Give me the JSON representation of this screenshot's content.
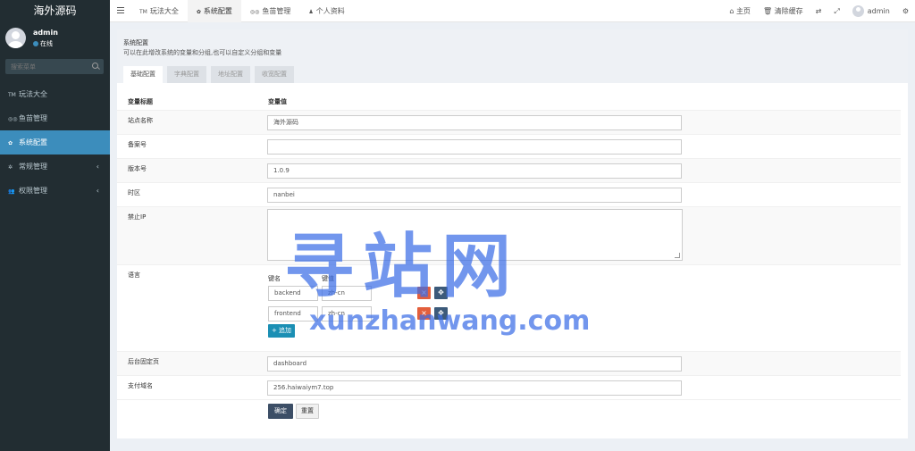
{
  "app": {
    "title": "海外源码"
  },
  "user": {
    "name": "admin",
    "status": "在线"
  },
  "sidebar": {
    "search_placeholder": "搜索菜单",
    "items": [
      {
        "label": "玩法大全",
        "icon": "tm-icon"
      },
      {
        "label": "鱼苗管理",
        "icon": "glasses-icon"
      },
      {
        "label": "系统配置",
        "icon": "gear-icon",
        "active": true
      },
      {
        "label": "常规管理",
        "icon": "cogs-icon",
        "has_children": true
      },
      {
        "label": "权限管理",
        "icon": "users-icon",
        "has_children": true
      }
    ]
  },
  "topnav": {
    "tabs": [
      {
        "label": "玩法大全",
        "icon": "tm-icon"
      },
      {
        "label": "系统配置",
        "icon": "gear-icon",
        "active": true
      },
      {
        "label": "鱼苗管理",
        "icon": "glasses-icon"
      },
      {
        "label": "个人资料",
        "icon": "user-icon"
      }
    ],
    "home_label": "主页",
    "clear_cache_label": "清除缓存",
    "username": "admin"
  },
  "page": {
    "title": "系统配置",
    "description": "可以在此增改系统的变量和分组,也可以自定义分组和变量",
    "sub_tabs": [
      "基础配置",
      "字典配置",
      "地址配置",
      "收宽配置"
    ],
    "col_title": "变量标题",
    "col_value": "变量值",
    "fields": {
      "site_name": {
        "label": "站点名称",
        "value": "海外源码"
      },
      "beian": {
        "label": "备案号",
        "value": ""
      },
      "version": {
        "label": "版本号",
        "value": "1.0.9"
      },
      "timezone": {
        "label": "时区",
        "value": "nanbei"
      },
      "forbidden_ip": {
        "label": "禁止IP",
        "value": ""
      },
      "language": {
        "label": "语言",
        "key_header": "键名",
        "value_header": "键值",
        "rows": [
          {
            "key": "backend",
            "value": "zh-cn"
          },
          {
            "key": "frontend",
            "value": "zh-cn"
          }
        ],
        "add_label": "追加"
      },
      "admin_home": {
        "label": "后台固定页",
        "value": "dashboard"
      },
      "pay_domain": {
        "label": "支付域名",
        "value": "256.haiwaiym7.top"
      }
    },
    "confirm_label": "确定",
    "reset_label": "重置"
  },
  "watermark": {
    "main": "寻站网",
    "sub": "xunzhanwang.com"
  },
  "colors": {
    "sidebar_bg": "#222d32",
    "accent": "#3c8dbc",
    "delete": "#e35f3c",
    "primary_btn": "#3c4e66"
  }
}
